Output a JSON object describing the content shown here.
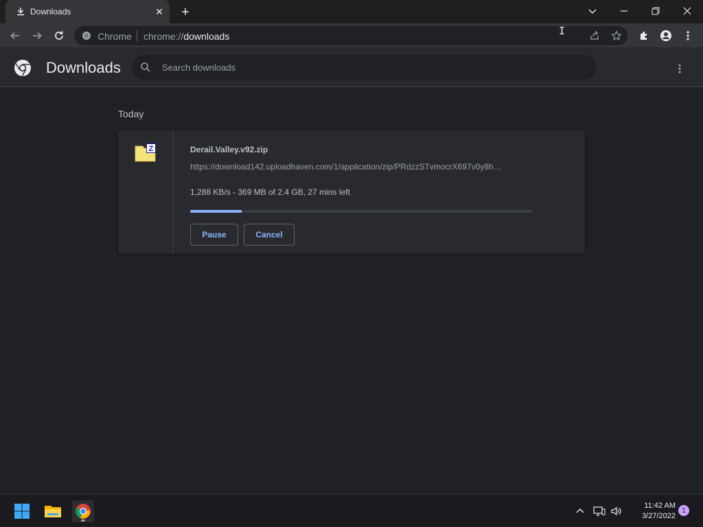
{
  "tab": {
    "title": "Downloads",
    "icon": "download-icon",
    "close_icon": "close-icon"
  },
  "new_tab_icon": "plus-icon",
  "window_controls": [
    "chevron-down-icon",
    "minimize-icon",
    "restore-icon",
    "close-icon"
  ],
  "toolbar": {
    "back_icon": "back-arrow-icon",
    "forward_icon": "forward-arrow-icon",
    "reload_icon": "reload-icon",
    "omnibox": {
      "site_label": "Chrome",
      "url_prefix": "chrome://",
      "url_path": "downloads"
    },
    "actions": [
      "share-icon",
      "star-icon",
      "extensions-icon",
      "profile-icon",
      "menu-icon"
    ]
  },
  "page": {
    "title": "Downloads",
    "search_placeholder": "Search downloads",
    "more_icon": "more-vert-icon"
  },
  "section_label": "Today",
  "download": {
    "file_name": "Derail.Valley.v92.zip",
    "url": "https://download142.uploadhaven.com/1/application/zip/PRdzzSTvmocrX697v0y8h…",
    "status": "1,288 KB/s - 369 MB of 2.4 GB, 27 mins left",
    "progress_fraction": 0.15,
    "pause_label": "Pause",
    "cancel_label": "Cancel",
    "file_icon": "zip-archive-icon"
  },
  "taskbar": {
    "apps": [
      "windows-start-icon",
      "file-explorer-icon",
      "chrome-icon"
    ],
    "tray": [
      "chevron-up-icon",
      "network-icon",
      "volume-icon"
    ],
    "time": "11:42 AM",
    "date": "3/27/2022",
    "notification_count": "1"
  },
  "colors": {
    "accent": "#8ab4f8",
    "background": "#202124",
    "surface": "#292a2d"
  }
}
